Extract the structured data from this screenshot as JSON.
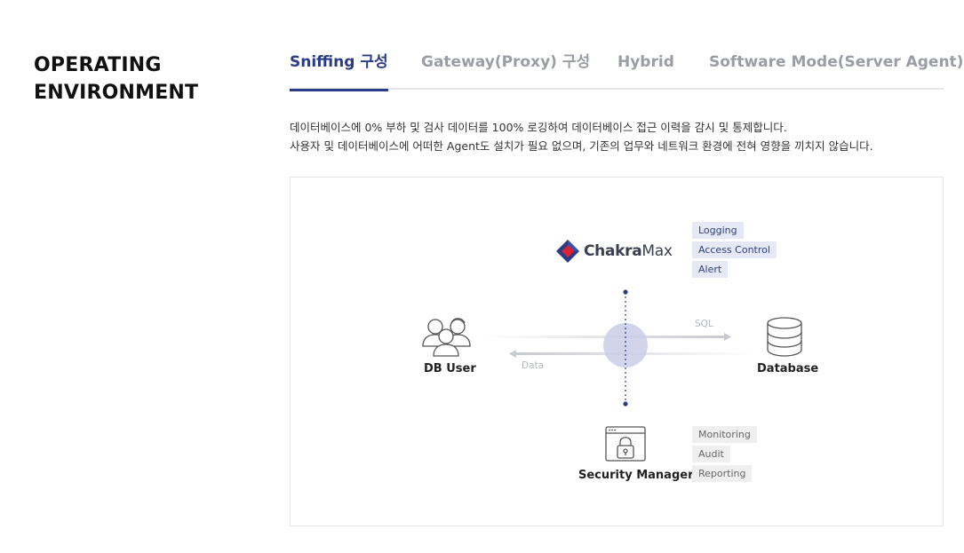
{
  "section": {
    "title_line1": "OPERATING",
    "title_line2": "ENVIRONMENT"
  },
  "tabs": [
    {
      "label": "Sniffing 구성",
      "active": true
    },
    {
      "label": "Gateway(Proxy) 구성",
      "active": false
    },
    {
      "label": "Hybrid",
      "active": false
    },
    {
      "label": "Software Mode(Server Agent)",
      "active": false
    }
  ],
  "description": {
    "line1": "데이터베이스에 0% 부하 및 검사 데이터를 100% 로깅하여 데이터베이스 접근 이력을 감시 및 통제합니다.",
    "line2": "사용자 및 데이터베이스에 어떠한 Agent도 설치가 필요 없으며, 기존의 업무와 네트워크 환경에 전혀 영향을 끼치지 않습니다."
  },
  "diagram": {
    "logo": {
      "name_bold": "Chakra",
      "name_regular": "Max"
    },
    "chakra_tags": [
      "Logging",
      "Access Control",
      "Alert"
    ],
    "db_user_label": "DB User",
    "database_label": "Database",
    "sql_label": "SQL",
    "data_label": "Data",
    "security_manager_label": "Security Manager",
    "manager_tags": [
      "Monitoring",
      "Audit",
      "Reporting"
    ]
  },
  "colors": {
    "accent": "#2b3c86",
    "tab_inactive": "#9a9da3",
    "tag_blue_bg": "#e6e9f5",
    "tag_gray_bg": "#efefef",
    "sniff_circle": "#c9cde6"
  }
}
